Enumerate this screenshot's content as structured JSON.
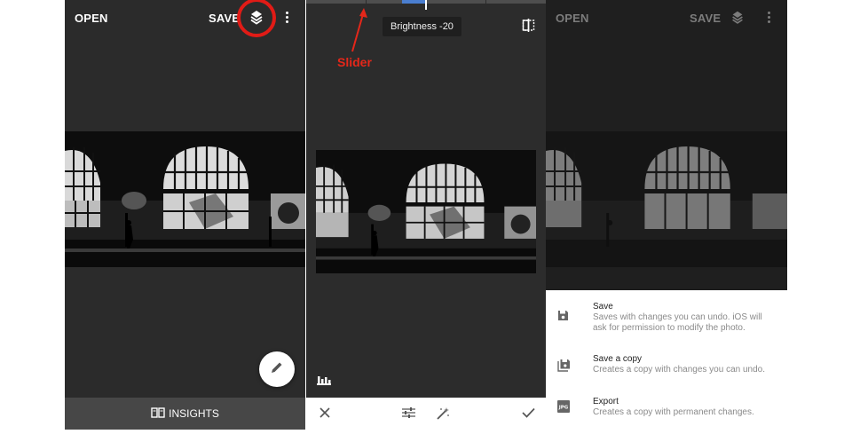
{
  "colors": {
    "accent_red": "#e11b16",
    "slider_blue": "#4a7ed0",
    "dark_bg": "#2b2b2b",
    "insights_bar": "#474747"
  },
  "panel1": {
    "open_label": "OPEN",
    "save_label": "SAVE",
    "looks_icon": "stacked-layers-icon",
    "menu_icon": "more-vert-icon",
    "fab_icon": "pencil-icon",
    "insights_label": "INSIGHTS",
    "insights_icon": "book-icon"
  },
  "panel2": {
    "slider_value": 0.5,
    "tooltip": "Brightness -20",
    "compare_icon": "compare-icon",
    "histogram_icon": "histogram-icon",
    "annotation_label": "Slider",
    "toolbar": {
      "cancel_icon": "close-icon",
      "adjust_icon": "tune-icon",
      "auto_icon": "magic-wand-icon",
      "apply_icon": "check-icon"
    }
  },
  "panel3": {
    "open_label": "OPEN",
    "save_label": "SAVE",
    "looks_icon": "stacked-layers-icon",
    "menu_icon": "more-vert-icon",
    "options": [
      {
        "title": "Save",
        "desc": "Saves with changes you can undo. iOS will ask for permission to modify the photo.",
        "icon": "save-icon"
      },
      {
        "title": "Save a copy",
        "desc": "Creates a copy with changes you can undo.",
        "icon": "save-copy-icon"
      },
      {
        "title": "Export",
        "desc": "Creates a copy with permanent changes.",
        "icon": "jpg-file-icon"
      }
    ]
  }
}
